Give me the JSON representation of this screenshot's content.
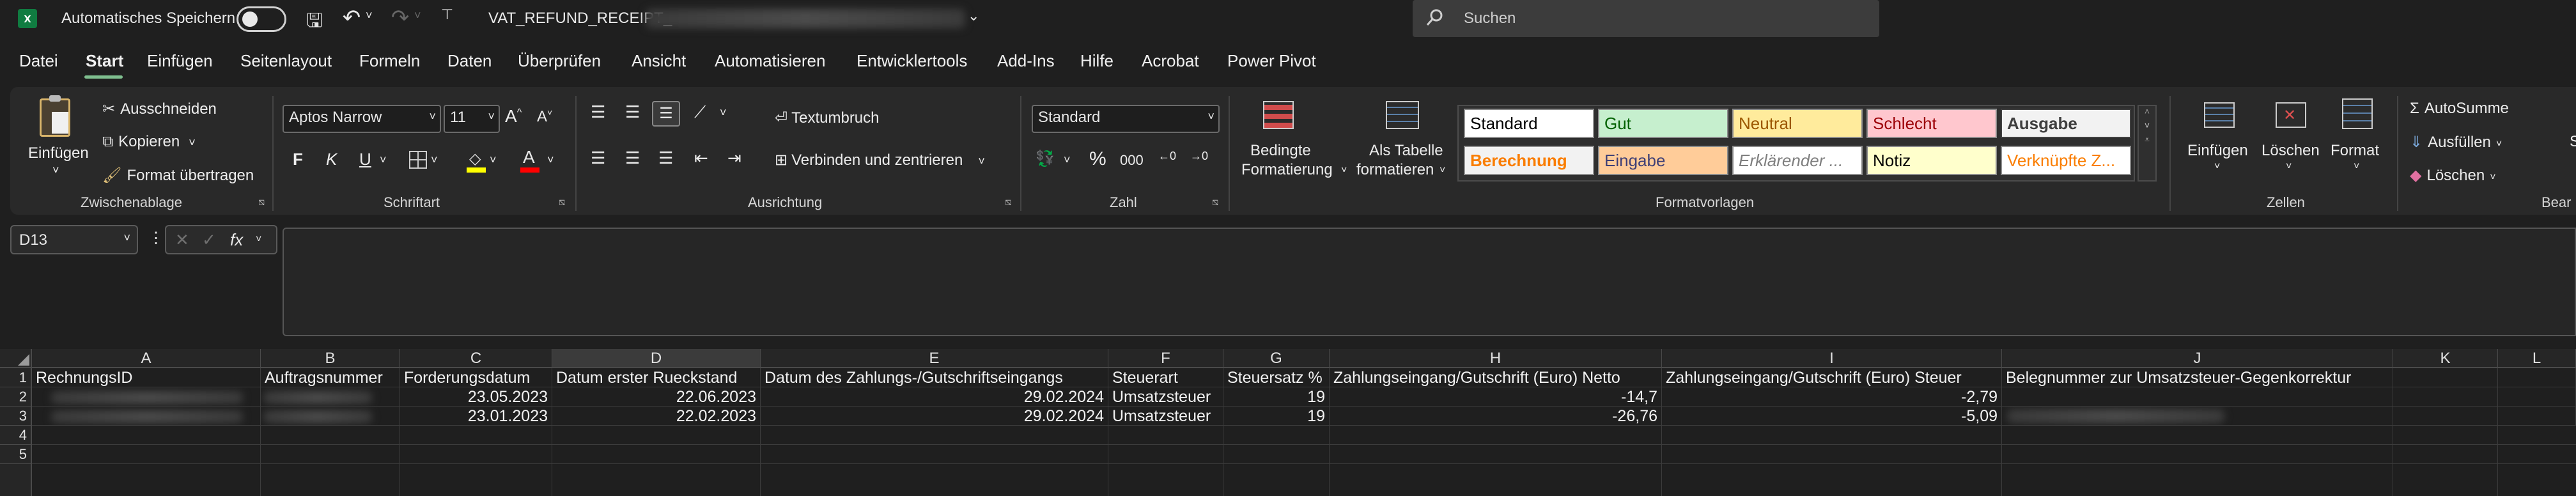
{
  "titlebar": {
    "autosave_label": "Automatisches Speichern",
    "filename": "VAT_REFUND_RECEIPT_",
    "search_placeholder": "Suchen"
  },
  "menu": [
    "Datei",
    "Start",
    "Einfügen",
    "Seitenlayout",
    "Formeln",
    "Daten",
    "Überprüfen",
    "Ansicht",
    "Automatisieren",
    "Entwicklertools",
    "Add-Ins",
    "Hilfe",
    "Acrobat",
    "Power Pivot"
  ],
  "ribbon": {
    "clipboard": {
      "paste": "Einfügen",
      "cut": "Ausschneiden",
      "copy": "Kopieren",
      "format_painter": "Format übertragen",
      "label": "Zwischenablage"
    },
    "font": {
      "name": "Aptos Narrow",
      "size": "11",
      "grow": "A^",
      "shrink": "A˅",
      "bold": "F",
      "italic": "K",
      "underline": "U",
      "label": "Schriftart"
    },
    "alignment": {
      "wrap": "Textumbruch",
      "merge": "Verbinden und zentrieren",
      "label": "Ausrichtung"
    },
    "number": {
      "format": "Standard",
      "percent": "%",
      "thousands": "000",
      "label": "Zahl"
    },
    "styles": {
      "conditional": [
        "Bedingte",
        "Formatierung"
      ],
      "as_table": [
        "Als Tabelle",
        "formatieren"
      ],
      "cells": [
        {
          "text": "Standard",
          "bg": "#ffffff",
          "fg": "#000000"
        },
        {
          "text": "Gut",
          "bg": "#c6efce",
          "fg": "#006100"
        },
        {
          "text": "Neutral",
          "bg": "#ffeb9c",
          "fg": "#9c5700"
        },
        {
          "text": "Schlecht",
          "bg": "#ffc7ce",
          "fg": "#9c0006"
        },
        {
          "text": "Ausgabe",
          "bg": "#f2f2f2",
          "fg": "#3f3f3f"
        },
        {
          "text": "Berechnung",
          "bg": "#f2f2f2",
          "fg": "#fa7d00"
        },
        {
          "text": "Eingabe",
          "bg": "#ffcc99",
          "fg": "#3f3f76"
        },
        {
          "text": "Erklärender ...",
          "bg": "#ffffff",
          "fg": "#7f7f7f"
        },
        {
          "text": "Notiz",
          "bg": "#ffffcc",
          "fg": "#000000"
        },
        {
          "text": "Verknüpfte Z...",
          "bg": "#ffffff",
          "fg": "#fa7d00"
        }
      ],
      "label": "Formatvorlagen"
    },
    "cells": {
      "insert": "Einfügen",
      "delete": "Löschen",
      "format": "Format",
      "label": "Zellen"
    },
    "editing": {
      "autosum": "AutoSumme",
      "fill": "Ausfüllen",
      "clear": "Löschen",
      "label": "Bear"
    }
  },
  "formula_bar": {
    "namebox": "D13",
    "fx": "fx"
  },
  "sheet": {
    "columns": [
      "A",
      "B",
      "C",
      "D",
      "E",
      "F",
      "G",
      "H",
      "I",
      "J",
      "K",
      "L"
    ],
    "rows": [
      "1",
      "2",
      "3",
      "4",
      "5"
    ],
    "header": [
      "RechnungsID",
      "Auftragsnummer",
      "Forderungsdatum",
      "Datum erster Rueckstand",
      "Datum des Zahlungs-/Gutschriftseingangs",
      "Steuerart",
      "Steuersatz %",
      "Zahlungseingang/Gutschrift (Euro) Netto",
      "Zahlungseingang/Gutschrift (Euro) Steuer",
      "Belegnummer zur Umsatzsteuer-Gegenkorrektur"
    ],
    "data": [
      {
        "c": "23.05.2023",
        "d": "22.06.2023",
        "e": "29.02.2024",
        "f": "Umsatzsteuer",
        "g": "19",
        "h": "-14,7",
        "i": "-2,79"
      },
      {
        "c": "23.01.2023",
        "d": "22.02.2023",
        "e": "29.02.2024",
        "f": "Umsatzsteuer",
        "g": "19",
        "h": "-26,76",
        "i": "-5,09"
      }
    ]
  }
}
